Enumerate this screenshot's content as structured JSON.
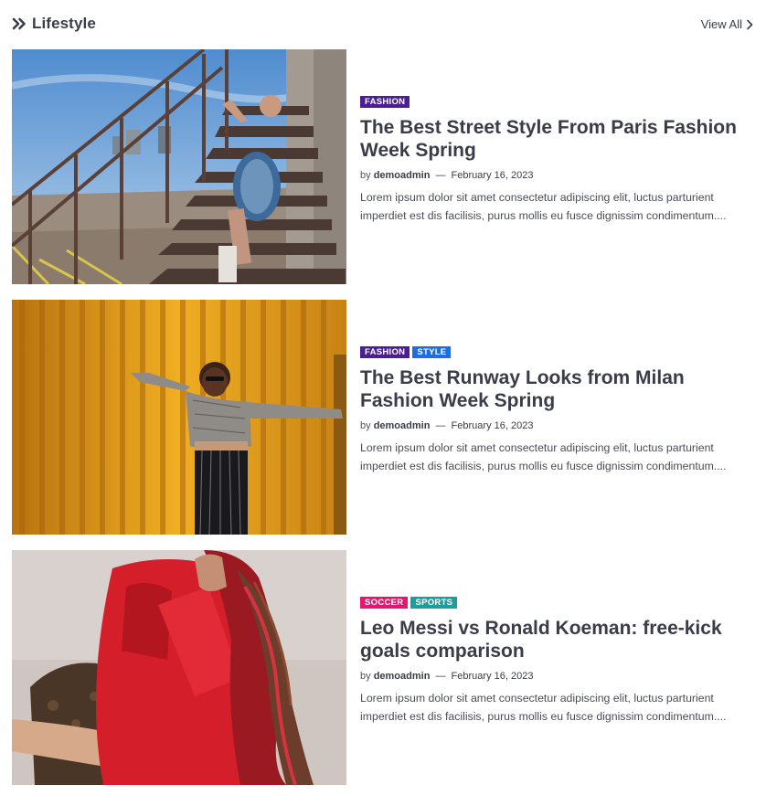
{
  "section": {
    "title": "Lifestyle",
    "view_all_label": "View All"
  },
  "posts": [
    {
      "badges": [
        {
          "label": "FASHION",
          "color": "#4b1e94"
        }
      ],
      "title": "The Best Street Style From Paris Fashion Week Spring",
      "by": "by",
      "author": "demoadmin",
      "dash": "—",
      "date": "February 16, 2023",
      "excerpt": "Lorem ipsum dolor sit amet consectetur adipiscing elit, luctus parturient imperdiet est dis facilisis, purus mollis eu fusce dignissim condimentum...."
    },
    {
      "badges": [
        {
          "label": "FASHION",
          "color": "#4b1e94"
        },
        {
          "label": "STYLE",
          "color": "#1a6ee8"
        }
      ],
      "title": "The Best Runway Looks from Milan Fashion Week Spring",
      "by": "by",
      "author": "demoadmin",
      "dash": "—",
      "date": "February 16, 2023",
      "excerpt": "Lorem ipsum dolor sit amet consectetur adipiscing elit, luctus parturient imperdiet est dis facilisis, purus mollis eu fusce dignissim condimentum...."
    },
    {
      "badges": [
        {
          "label": "SOCCER",
          "color": "#e6156f"
        },
        {
          "label": "SPORTS",
          "color": "#1e9e9b"
        }
      ],
      "title": "Leo Messi vs Ronald Koeman: free-kick goals comparison",
      "by": "by",
      "author": "demoadmin",
      "dash": "—",
      "date": "February 16, 2023",
      "excerpt": "Lorem ipsum dolor sit amet consectetur adipiscing elit, luctus parturient imperdiet est dis facilisis, purus mollis eu fusce dignissim condimentum...."
    }
  ],
  "icons": {
    "section_marker": "double-chevron-right-icon",
    "view_all": "chevron-right-icon"
  }
}
